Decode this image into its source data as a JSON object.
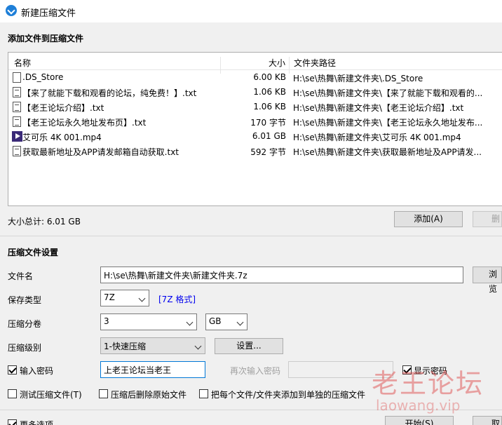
{
  "window": {
    "title": "新建压缩文件"
  },
  "add_section": {
    "title": "添加文件到压缩文件"
  },
  "filelist": {
    "columns": {
      "name": "名称",
      "size": "大小",
      "path": "文件夹路径"
    },
    "rows": [
      {
        "icon": "document-icon",
        "name": ".DS_Store",
        "size": "6.00 KB",
        "path": "H:\\se\\热舞\\新建文件夹\\.DS_Store"
      },
      {
        "icon": "document-lines-icon",
        "name": "【来了就能下载和观看的论坛，纯免费！】.txt",
        "size": "1.06 KB",
        "path": "H:\\se\\热舞\\新建文件夹\\【来了就能下载和观看的..."
      },
      {
        "icon": "document-lines-icon",
        "name": "【老王论坛介绍】.txt",
        "size": "1.06 KB",
        "path": "H:\\se\\热舞\\新建文件夹\\【老王论坛介绍】.txt"
      },
      {
        "icon": "document-lines-icon",
        "name": "【老王论坛永久地址发布页】.txt",
        "size": "170 字节",
        "path": "H:\\se\\热舞\\新建文件夹\\【老王论坛永久地址发布..."
      },
      {
        "icon": "video-icon",
        "name": "艾可乐 4K 001.mp4",
        "size": "6.01 GB",
        "path": "H:\\se\\热舞\\新建文件夹\\艾可乐 4K 001.mp4"
      },
      {
        "icon": "document-lines-icon",
        "name": "获取最新地址及APP请发邮箱自动获取.txt",
        "size": "592 字节",
        "path": "H:\\se\\热舞\\新建文件夹\\获取最新地址及APP请发..."
      }
    ]
  },
  "total_size": "大小总计: 6.01 GB",
  "buttons": {
    "add": "添加(A)",
    "delete": "删",
    "browse": "浏览",
    "settings": "设置...",
    "start": "开始(S)",
    "cancel": "取"
  },
  "settings_section": {
    "title": "压缩文件设置",
    "filename_label": "文件名",
    "filename_value": "H:\\se\\热舞\\新建文件夹\\新建文件夹.7z",
    "type_label": "保存类型",
    "type_value": "7Z",
    "type_link": "[7Z 格式]",
    "split_label": "压缩分卷",
    "split_value": "3",
    "split_unit": "GB",
    "level_label": "压缩级别",
    "level_value": "1-快速压缩",
    "password_label": "输入密码",
    "password_value": "上老王论坛当老王",
    "password_checked": true,
    "repeat_label": "再次输入密码",
    "show_password_label": "显示密码",
    "show_password_checked": true,
    "test_label": "测试压缩文件(T)",
    "delete_after_label": "压缩后删除原始文件",
    "each_separate_label": "把每个文件/文件夹添加到单独的压缩文件",
    "more_options_label": "更多选项"
  },
  "watermark": {
    "text": "老王论坛",
    "sub": "laowang.vip"
  }
}
